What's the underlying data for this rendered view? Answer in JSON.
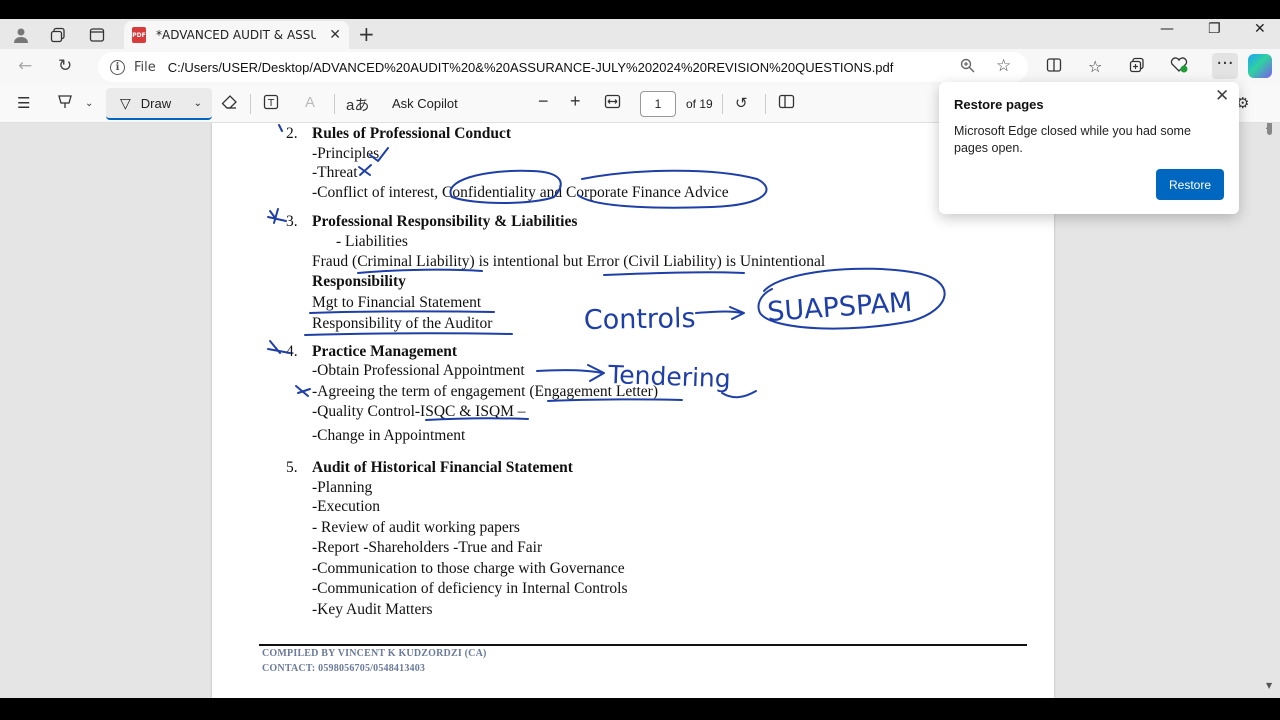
{
  "tab": {
    "title": "*ADVANCED AUDIT & ASSURANCE",
    "pdf_badge": "PDF"
  },
  "address": {
    "scheme_label": "File",
    "url": "C:/Users/USER/Desktop/ADVANCED%20AUDIT%20&%20ASSURANCE-JULY%202024%20REVISION%20QUESTIONS.pdf"
  },
  "pdf_toolbar": {
    "draw_label": "Draw",
    "ask_label": "Ask Copilot",
    "page_value": "1",
    "page_total": "of 19"
  },
  "popup": {
    "title": "Restore pages",
    "message": "Microsoft Edge closed while you had some pages open.",
    "button": "Restore"
  },
  "document": {
    "s2_num": "2.",
    "s2_title": "Rules of Professional Conduct",
    "s2_l1": "-Principles",
    "s2_l2": "-Threat",
    "s2_l3": "-Conflict of interest, Confidentiality and Corporate Finance Advice",
    "s3_num": "3.",
    "s3_title": "Professional Responsibility & Liabilities",
    "s3_l1": "- Liabilities",
    "s3_l2": "Fraud (Criminal Liability) is intentional but Error (Civil Liability) is Unintentional",
    "s3_l3": "Responsibility",
    "s3_l4": "Mgt to Financial Statement",
    "s3_l5": "Responsibility of the Auditor",
    "s4_num": "4.",
    "s4_title": "Practice Management",
    "s4_l1": "-Obtain Professional Appointment",
    "s4_l2": "-Agreeing the term of engagement (Engagement Letter)",
    "s4_l3": "-Quality Control-ISQC & ISQM –",
    "s4_l4": "-Change in Appointment",
    "s5_num": "5.",
    "s5_title": "Audit of Historical Financial Statement",
    "s5_l1": "-Planning",
    "s5_l2": "-Execution",
    "s5_l3": "- Review of audit working papers",
    "s5_l4": "-Report -Shareholders -True and Fair",
    "s5_l5": "-Communication to those charge with Governance",
    "s5_l6": "-Communication of deficiency in Internal Controls",
    "s5_l7": "-Key Audit Matters",
    "footer_1": "COMPILED BY VINCENT K KUDZORDZI (CA)",
    "footer_2": "CONTACT: 0598056705/0548413403"
  },
  "ink_annotations": {
    "controls": "Controls",
    "suapspam": "SUAPSPAM",
    "tendering": "Tendering"
  },
  "colors": {
    "accent": "#0067c0",
    "ink": "#1e3fa8"
  }
}
